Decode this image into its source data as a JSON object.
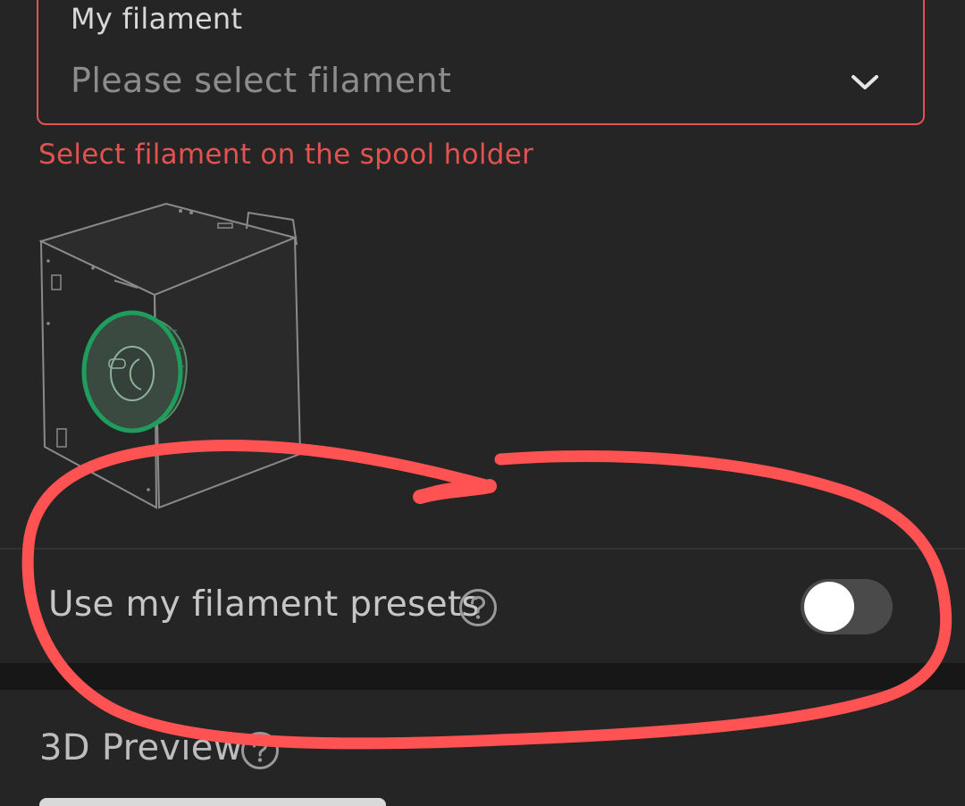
{
  "filament_select": {
    "label": "My filament",
    "placeholder": "Please select filament",
    "error": "Select filament on the spool holder",
    "icon": "chevron-down-icon"
  },
  "spool_illustration": {
    "icon": "printer-spool-holder-illustration",
    "highlight_color": "#1f9d5c"
  },
  "presets": {
    "label": "Use my filament presets",
    "help_icon": "question-circle-icon",
    "toggle_on": false
  },
  "preview": {
    "label": "3D Preview",
    "help_icon": "question-circle-icon"
  },
  "colors": {
    "background": "#252525",
    "error": "#e2524f",
    "annotation": "#ff5252"
  }
}
